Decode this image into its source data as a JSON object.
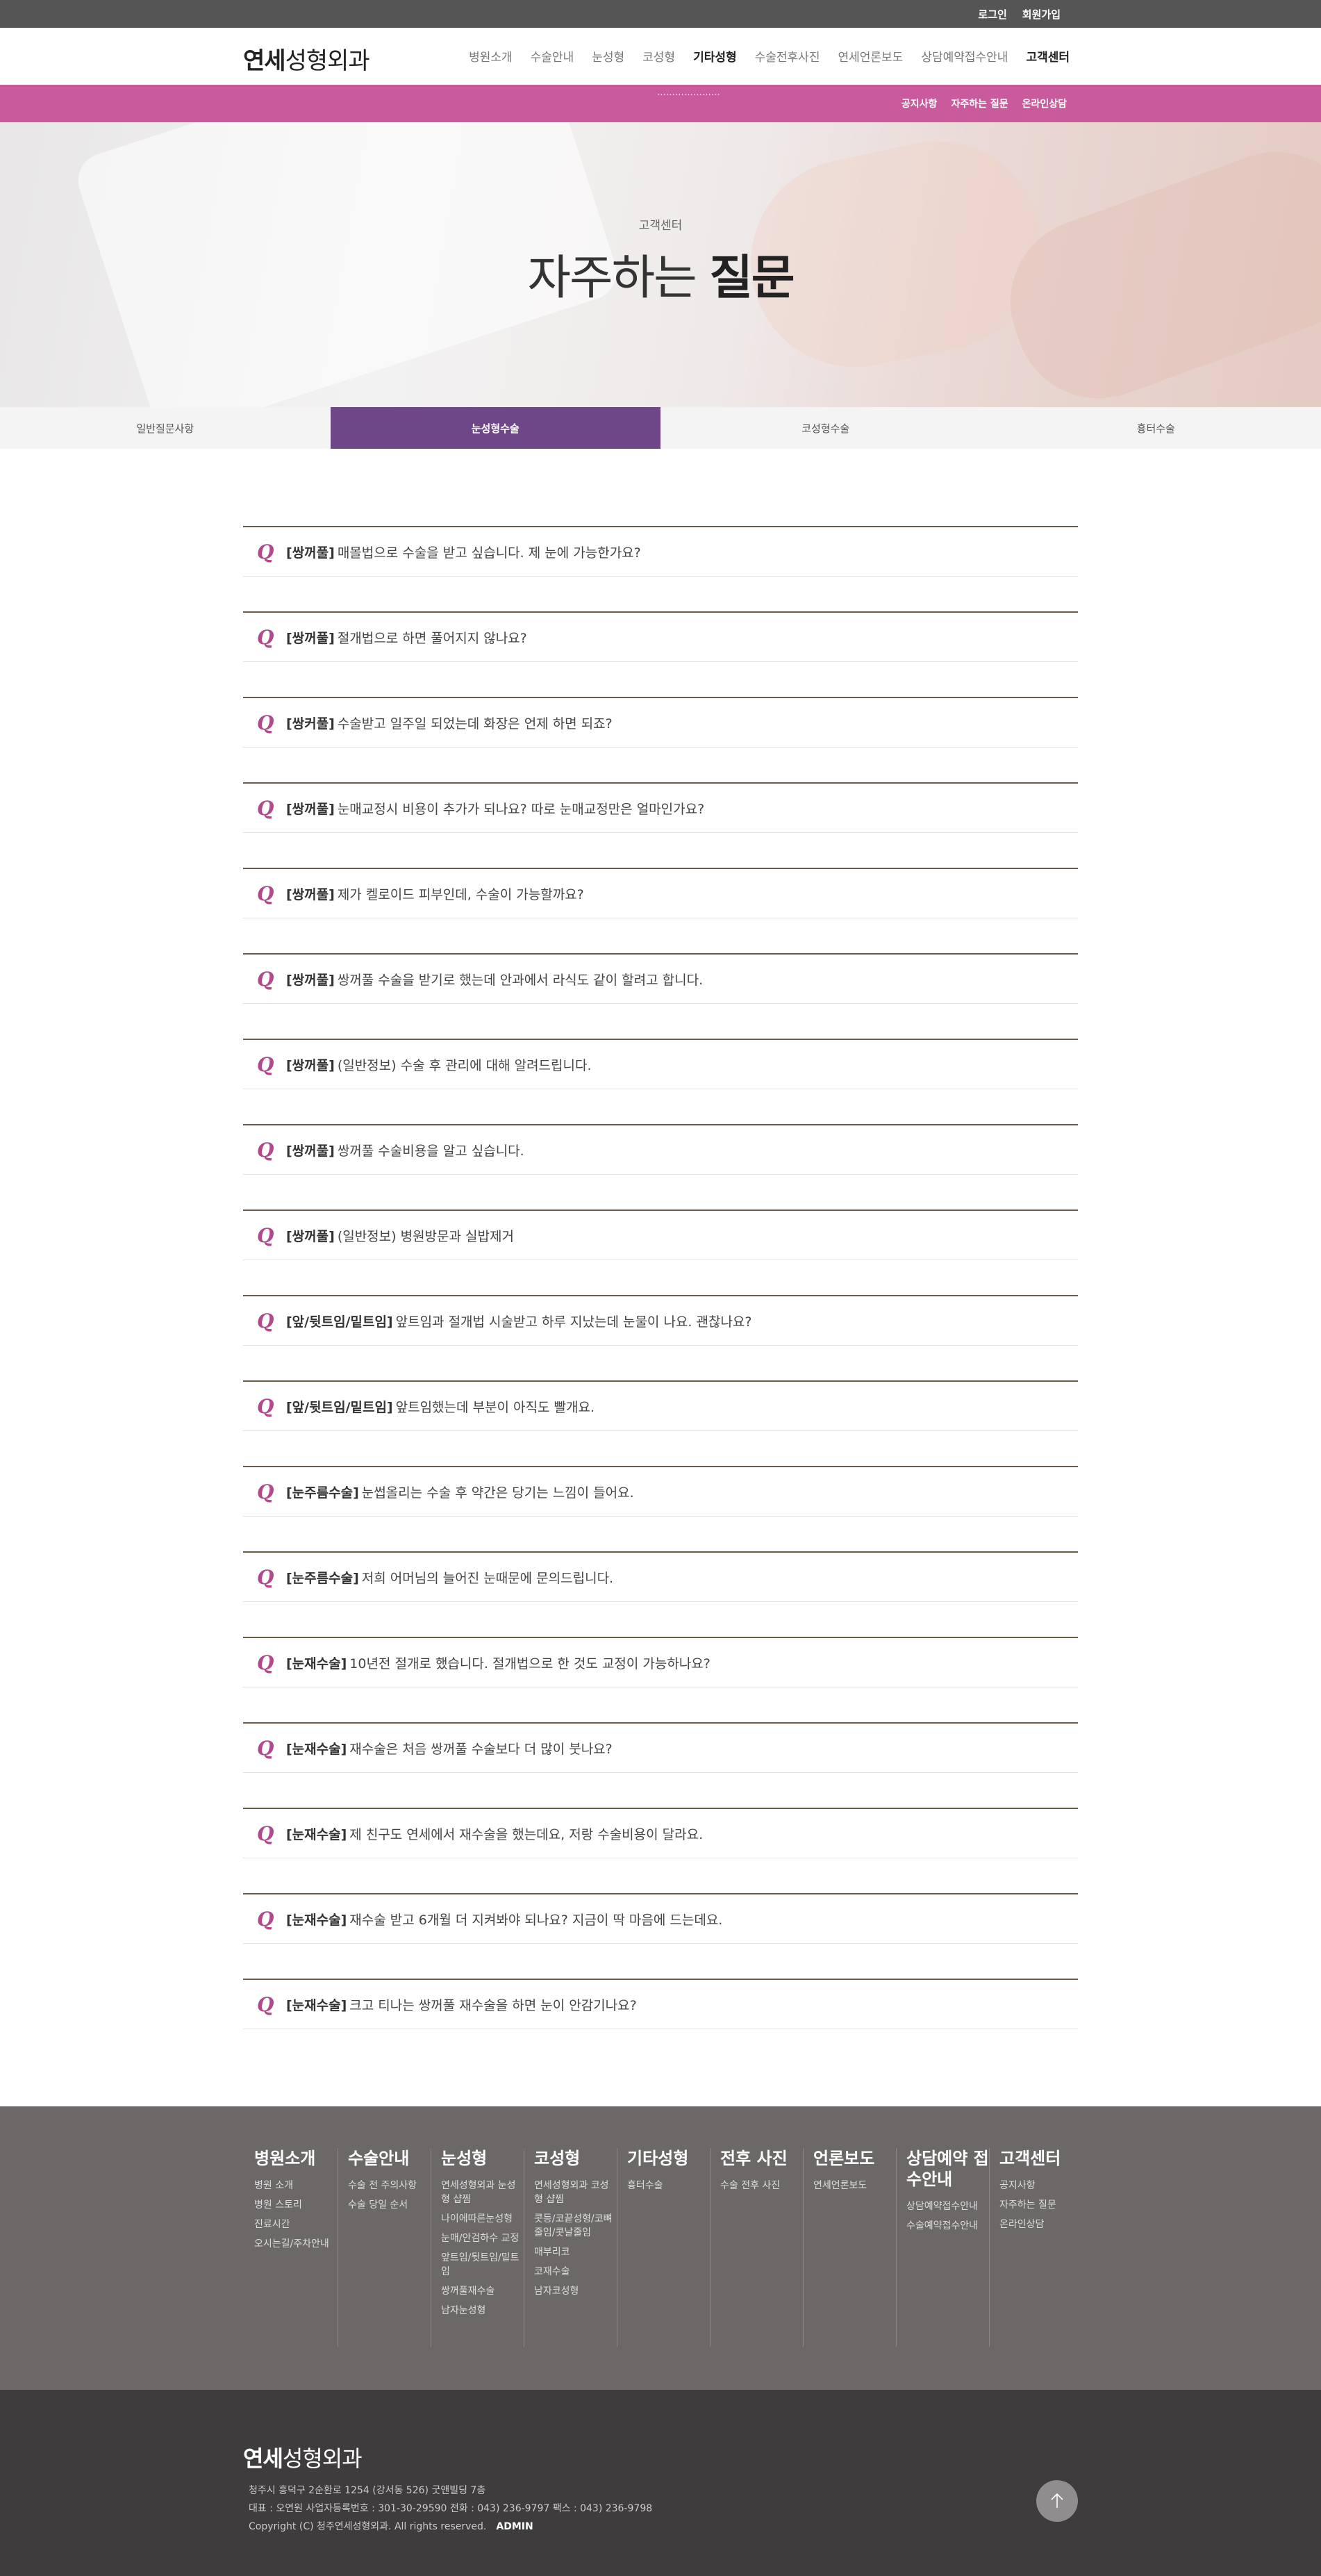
{
  "topbar": {
    "links": [
      "로그인",
      "회원가입"
    ]
  },
  "header": {
    "logo_bold": "연세",
    "logo_light": "성형외과",
    "nav": [
      "병원소개",
      "수술안내",
      "눈성형",
      "코성형",
      "기타성형",
      "수술전후사진",
      "연세언론보도",
      "상담예약접수안내",
      "고객센터"
    ]
  },
  "subnav": {
    "items": [
      "공지사항",
      "자주하는 질문",
      "온라인상담"
    ]
  },
  "hero": {
    "subtitle": "고객센터",
    "title_light": "자주하는",
    "title_bold": "질문"
  },
  "tabs": [
    "일반질문사항",
    "눈성형수술",
    "코성형수술",
    "흉터수술"
  ],
  "faq": [
    {
      "cat": "[쌍꺼풀]",
      "text": "매몰법으로 수술을 받고 싶습니다. 제 눈에 가능한가요?"
    },
    {
      "cat": "[쌍꺼풀]",
      "text": "절개법으로 하면 풀어지지 않나요?"
    },
    {
      "cat": "[쌍커풀]",
      "text": "수술받고 일주일 되었는데 화장은 언제 하면 되죠?"
    },
    {
      "cat": "[쌍꺼풀]",
      "text": "눈매교정시 비용이 추가가 되나요? 따로 눈매교정만은 얼마인가요?"
    },
    {
      "cat": "[쌍꺼풀]",
      "text": "제가 켈로이드 피부인데, 수술이 가능할까요?"
    },
    {
      "cat": "[쌍꺼풀]",
      "text": "쌍꺼풀 수술을 받기로 했는데 안과에서 라식도 같이 할려고 합니다."
    },
    {
      "cat": "[쌍꺼풀]",
      "text": "(일반정보) 수술 후 관리에 대해 알려드립니다."
    },
    {
      "cat": "[쌍꺼풀]",
      "text": "쌍꺼풀 수술비용을 알고 싶습니다."
    },
    {
      "cat": "[쌍꺼풀]",
      "text": "(일반정보) 병원방문과 실밥제거"
    },
    {
      "cat": "[앞/뒷트임/밑트임]",
      "text": "앞트임과 절개법 시술받고 하루 지났는데 눈물이 나요. 괜찮나요?"
    },
    {
      "cat": "[앞/뒷트임/밑트임]",
      "text": "앞트임했는데 부분이 아직도 빨개요."
    },
    {
      "cat": "[눈주름수술]",
      "text": "눈썹올리는 수술 후 약간은 당기는 느낌이 들어요."
    },
    {
      "cat": "[눈주름수술]",
      "text": "저희 어머님의 늘어진 눈때문에 문의드립니다."
    },
    {
      "cat": "[눈재수술]",
      "text": "10년전 절개로 했습니다. 절개법으로 한 것도 교정이 가능하나요?"
    },
    {
      "cat": "[눈재수술]",
      "text": "재수술은 처음 쌍꺼풀 수술보다 더 많이 붓나요?"
    },
    {
      "cat": "[눈재수술]",
      "text": "제 친구도 연세에서 재수술을 했는데요, 저랑 수술비용이 달라요."
    },
    {
      "cat": "[눈재수술]",
      "text": "재수술 받고 6개월 더 지켜봐야 되나요? 지금이 딱 마음에 드는데요."
    },
    {
      "cat": "[눈재수술]",
      "text": "크고 티나는 쌍꺼풀 재수술을 하면 눈이 안감기나요?"
    }
  ],
  "sitemap": [
    {
      "title": "병원소개",
      "links": [
        "병원 소개",
        "병원 스토리",
        "진료시간",
        "오시는길/주차안내"
      ]
    },
    {
      "title": "수술안내",
      "links": [
        "수술 전 주의사항",
        "수술 당일 순서"
      ]
    },
    {
      "title": "눈성형",
      "links": [
        "연세성형외과 눈성형 샵찜",
        "나이에따른눈성형",
        "눈매/안검하수 교정",
        "앞트임/뒷트임/밑트임",
        "쌍꺼풀재수술",
        "남자눈성형"
      ]
    },
    {
      "title": "코성형",
      "links": [
        "연세성형외과 코성형 샵찜",
        "콧등/코끝성형/코뼈줄임/콧날줄임",
        "매부리코",
        "코재수술",
        "남자코성형"
      ]
    },
    {
      "title": "기타성형",
      "links": [
        "흉터수술"
      ]
    },
    {
      "title": "전후 사진",
      "links": [
        "수술 전후 사진"
      ]
    },
    {
      "title": "언론보도",
      "links": [
        "연세언론보도"
      ]
    },
    {
      "title": "상담예약 접수안내",
      "links": [
        "상담예약접수안내",
        "수술예약접수안내"
      ]
    },
    {
      "title": "고객센터",
      "links": [
        "공지사항",
        "자주하는 질문",
        "온라인상담"
      ]
    }
  ],
  "footer": {
    "logo_bold": "연세",
    "logo_light": "성형외과",
    "address": "청주시 흥덕구 2순환로 1254 (강서동 526) 굿앤빌딩 7층",
    "info": "대표 : 오연원     사업자등록번호 : 301-30-29590     전화 : 043) 236-9797     팩스 : 043) 236-9798",
    "copyright": "Copyright (C) 청주연세성형외과. All rights reserved.",
    "admin": "ADMIN"
  }
}
